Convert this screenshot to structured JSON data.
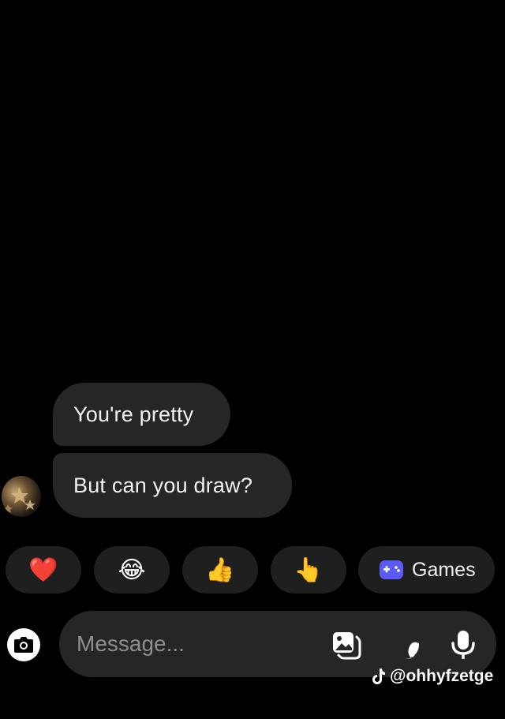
{
  "conversation": {
    "messages": [
      {
        "text": "You're pretty"
      },
      {
        "text": "But can you draw?"
      }
    ]
  },
  "quick_replies": {
    "reactions": [
      {
        "emoji": "❤️",
        "icon": "heart-icon"
      },
      {
        "emoji": "😂",
        "icon": "laughing-icon"
      },
      {
        "emoji": "👍",
        "icon": "thumbs-up-icon"
      },
      {
        "emoji": "👆",
        "icon": "pointing-icon"
      }
    ],
    "games_label": "Games"
  },
  "composer": {
    "placeholder": "Message..."
  },
  "watermark": {
    "handle": "@ohhyfzetge"
  },
  "colors": {
    "background": "#000000",
    "bubble": "#262626",
    "chip": "#1f1f1f",
    "games_accent": "#5b5bf5",
    "placeholder": "#8e8e8e"
  }
}
